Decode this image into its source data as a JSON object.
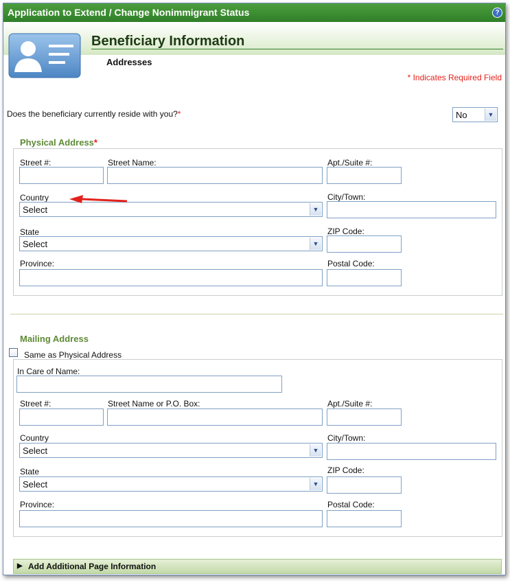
{
  "window": {
    "title": "Application to Extend / Change Nonimmigrant Status",
    "help_icon": "?"
  },
  "header": {
    "heading": "Beneficiary Information",
    "subheading": "Addresses"
  },
  "required_note": "* Indicates Required Field",
  "question": {
    "label": "Does the beneficiary currently reside with you?",
    "required_mark": "*",
    "value": "No"
  },
  "physical": {
    "legend": "Physical Address",
    "required_mark": "*",
    "street_num_label": "Street #:",
    "street_name_label": "Street Name:",
    "apt_label": "Apt./Suite #:",
    "country_label": "Country",
    "country_value": "Select",
    "city_label": "City/Town:",
    "state_label": "State",
    "state_value": "Select",
    "zip_label": "ZIP Code:",
    "province_label": "Province:",
    "postal_label": "Postal Code:"
  },
  "mailing": {
    "legend": "Mailing Address",
    "same_as_label": "Same as Physical Address",
    "same_as_checked": false,
    "care_of_label": "In Care of Name:",
    "street_num_label": "Street #:",
    "street_name_label": "Street Name or P.O. Box:",
    "apt_label": "Apt./Suite #:",
    "country_label": "Country",
    "country_value": "Select",
    "city_label": "City/Town:",
    "state_label": "State",
    "state_value": "Select",
    "zip_label": "ZIP Code:",
    "province_label": "Province:",
    "postal_label": "Postal Code:"
  },
  "footer": {
    "expander_label": "Add Additional Page Information"
  },
  "colors": {
    "title_green": "#2f7f28",
    "legend_green": "#5e8a35",
    "required_red": "#e3211b",
    "arrow_red": "#e3211b"
  }
}
